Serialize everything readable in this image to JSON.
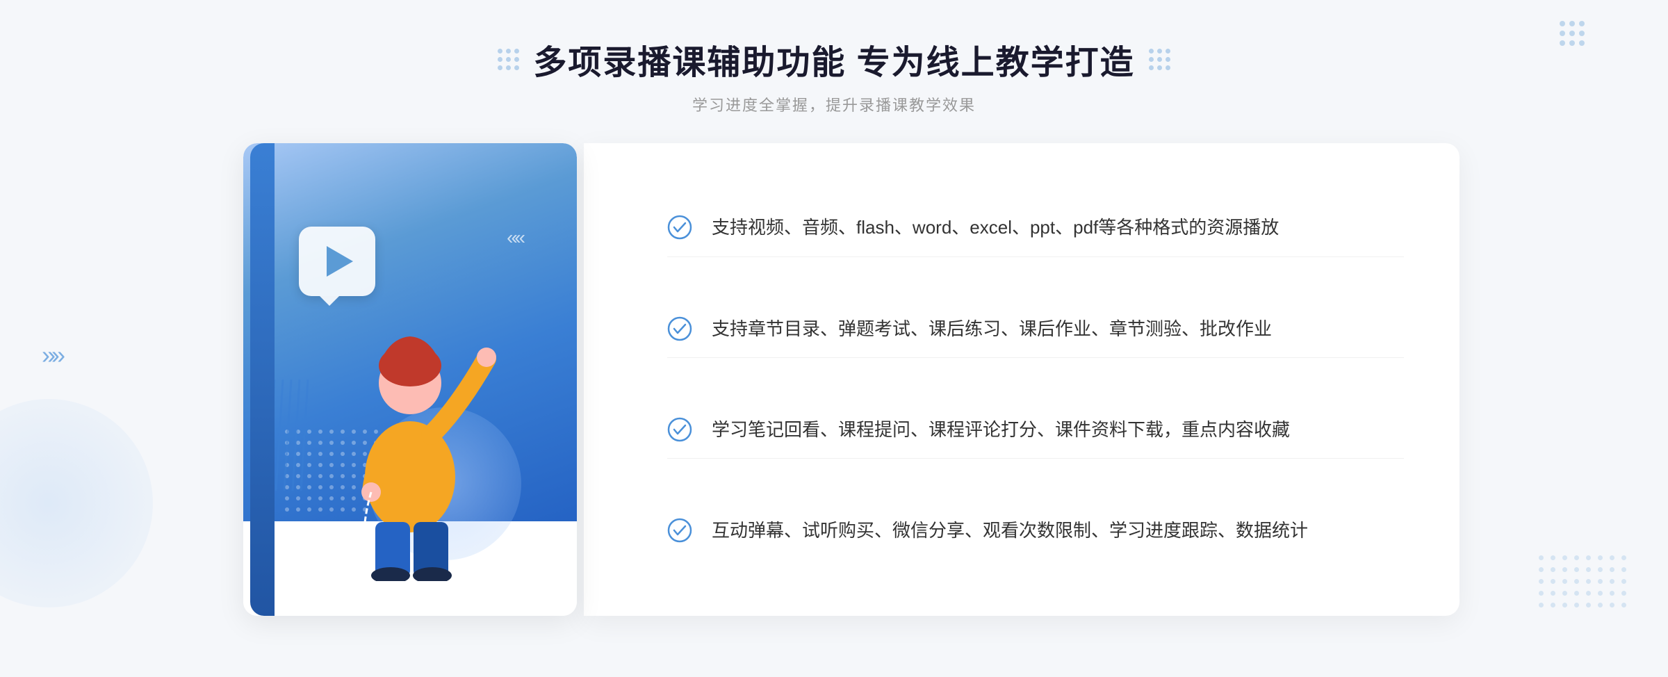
{
  "page": {
    "title": "多项录播课辅助功能 专为线上教学打造",
    "subtitle": "学习进度全掌握，提升录播课教学效果",
    "features": [
      {
        "id": "feature-1",
        "text": "支持视频、音频、flash、word、excel、ppt、pdf等各种格式的资源播放"
      },
      {
        "id": "feature-2",
        "text": "支持章节目录、弹题考试、课后练习、课后作业、章节测验、批改作业"
      },
      {
        "id": "feature-3",
        "text": "学习笔记回看、课程提问、课程评论打分、课件资料下载，重点内容收藏"
      },
      {
        "id": "feature-4",
        "text": "互动弹幕、试听购买、微信分享、观看次数限制、学习进度跟踪、数据统计"
      }
    ],
    "colors": {
      "primary": "#3a7fd4",
      "primary_light": "#5b9bd5",
      "primary_dark": "#2155a3",
      "text_dark": "#1a1a2e",
      "text_gray": "#999999",
      "text_main": "#333333",
      "accent_check": "#4a90d9"
    }
  }
}
